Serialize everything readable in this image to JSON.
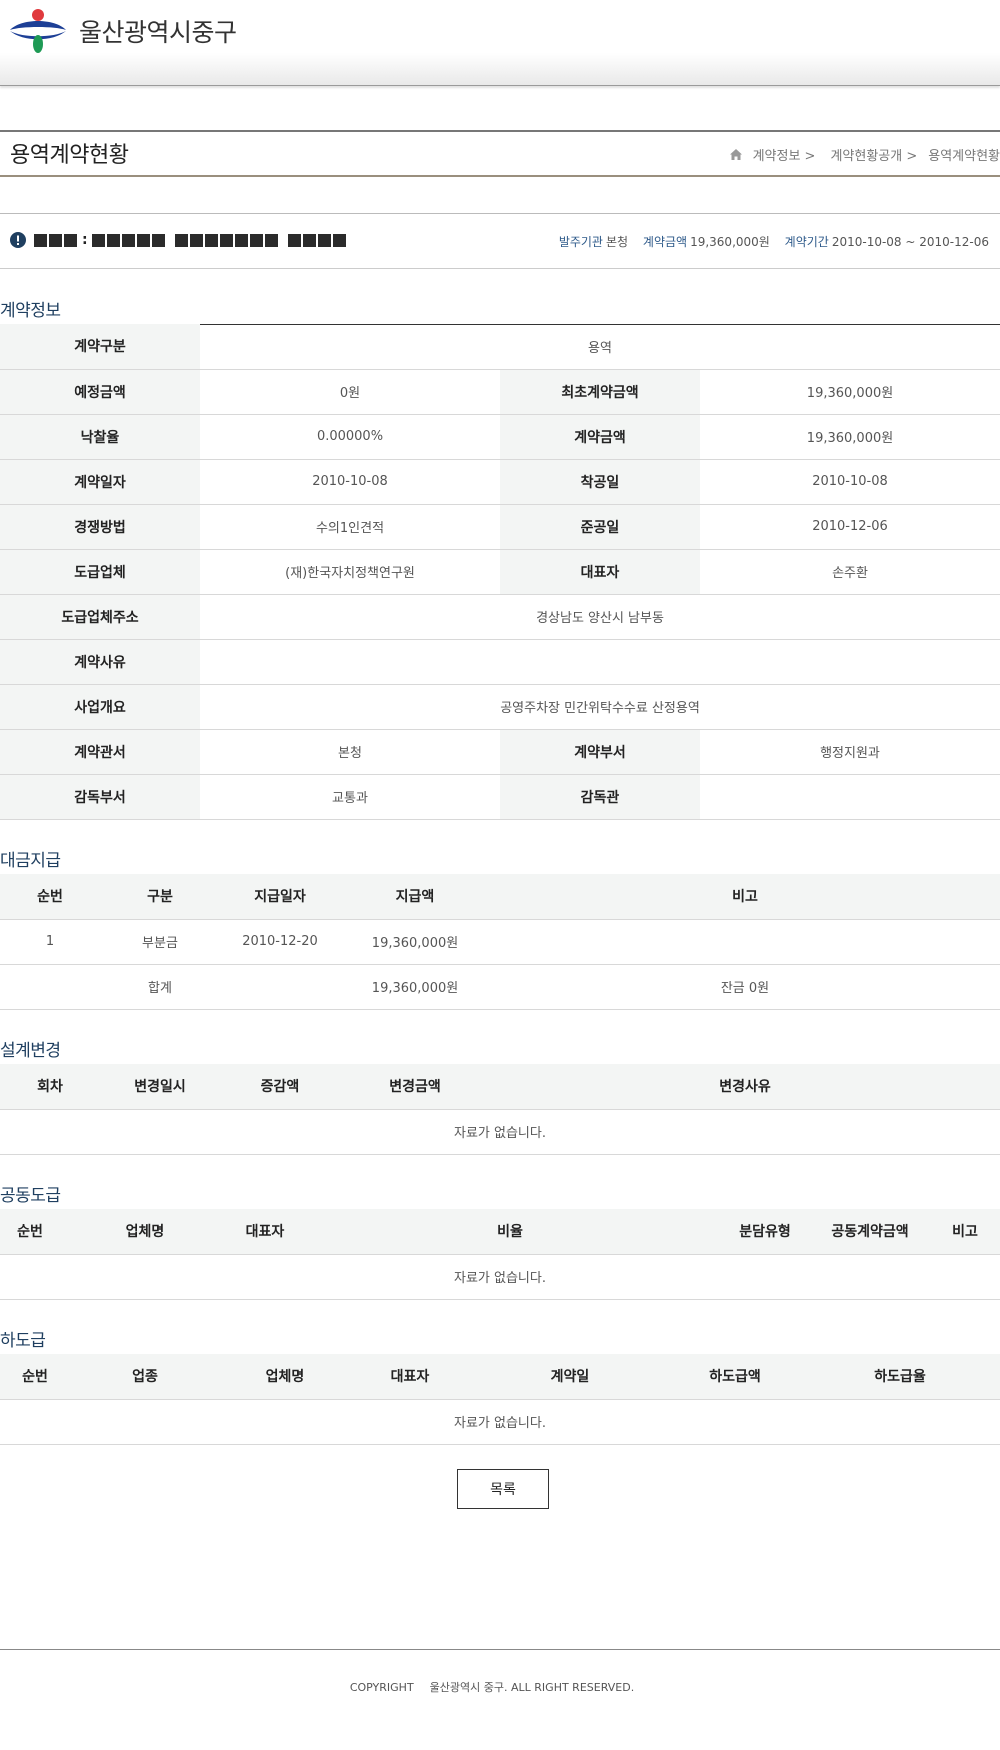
{
  "header": {
    "site_name": "울산광역시중구"
  },
  "page": {
    "title": "용역계약현황",
    "breadcrumb": [
      "계약정보 >",
      "계약현황공개 >",
      "용역계약현황"
    ]
  },
  "summary": {
    "items": [
      {
        "key": "발주기관",
        "value": "본청"
      },
      {
        "key": "계약금액",
        "value": "19,360,000원"
      },
      {
        "key": "계약기간",
        "value": "2010-10-08 ~ 2010-12-06"
      }
    ]
  },
  "contract_info": {
    "title": "계약정보",
    "type_label": "계약구분",
    "type_value": "용역",
    "est_label": "예정금액",
    "est_value": "0원",
    "init_amt_label": "최초계약금액",
    "init_amt_value": "19,360,000원",
    "rate_label": "낙찰율",
    "rate_value": "0.00000%",
    "amt_label": "계약금액",
    "amt_value": "19,360,000원",
    "date_label": "계약일자",
    "date_value": "2010-10-08",
    "start_label": "착공일",
    "start_value": "2010-10-08",
    "method_label": "경쟁방법",
    "method_value": "수의1인견적",
    "end_label": "준공일",
    "end_value": "2010-12-06",
    "vendor_label": "도급업체",
    "vendor_value": "(재)한국자치정책연구원",
    "ceo_label": "대표자",
    "ceo_value": "손주환",
    "addr_label": "도급업체주소",
    "addr_value": "경상남도 양산시 남부동",
    "reason_label": "계약사유",
    "reason_value": "",
    "overview_label": "사업개요",
    "overview_value": "공영주차장 민간위탁수수료 산정용역",
    "office_label": "계약관서",
    "office_value": "본청",
    "dept_label": "계약부서",
    "dept_value": "행정지원과",
    "sup_dept_label": "감독부서",
    "sup_dept_value": "교통과",
    "supervisor_label": "감독관",
    "supervisor_value": ""
  },
  "payment": {
    "title": "대금지급",
    "headers": [
      "순번",
      "구분",
      "지급일자",
      "지급액",
      "비고"
    ],
    "rows": [
      [
        "1",
        "부분금",
        "2010-12-20",
        "19,360,000원",
        ""
      ]
    ],
    "total_label": "합계",
    "total_amount": "19,360,000원",
    "balance": "잔금 0원"
  },
  "design_change": {
    "title": "설계변경",
    "headers": [
      "회차",
      "변경일시",
      "증감액",
      "변경금액",
      "변경사유"
    ],
    "empty": "자료가 없습니다."
  },
  "joint": {
    "title": "공동도급",
    "headers": [
      "순번",
      "업체명",
      "대표자",
      "비율",
      "분담유형",
      "공동계약금액",
      "비고"
    ],
    "empty": "자료가 없습니다."
  },
  "subcontract": {
    "title": "하도급",
    "headers": [
      "순번",
      "업종",
      "업체명",
      "대표자",
      "계약일",
      "하도급액",
      "하도급율"
    ],
    "empty": "자료가 없습니다."
  },
  "buttons": {
    "list": "목록"
  },
  "footer": {
    "copyright": "COPYRIGHT",
    "text": "울산광역시 중구. ALL RIGHT RESERVED."
  }
}
